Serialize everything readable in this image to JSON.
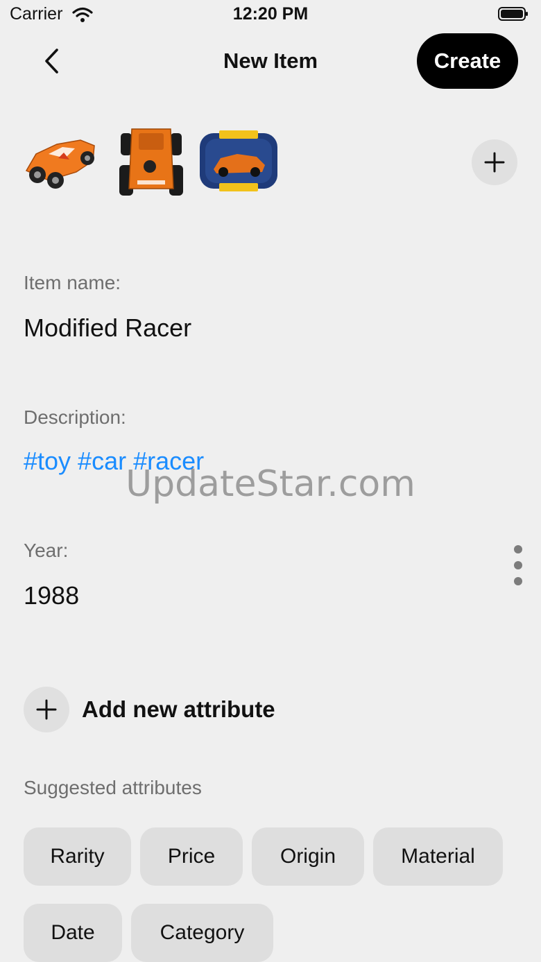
{
  "status_bar": {
    "carrier": "Carrier",
    "time": "12:20 PM"
  },
  "nav": {
    "title": "New Item",
    "create_label": "Create"
  },
  "form": {
    "name_label": "Item name:",
    "name_value": "Modified Racer",
    "description_label": "Description:",
    "description_value": "#toy #car #racer",
    "year_label": "Year:",
    "year_value": "1988"
  },
  "add_attribute_label": "Add new attribute",
  "suggested": {
    "label": "Suggested attributes",
    "chips": [
      "Rarity",
      "Price",
      "Origin",
      "Material",
      "Date",
      "Category"
    ]
  },
  "watermark": "UpdateStar.com",
  "colors": {
    "accent": "#1a8cff",
    "background": "#efefef",
    "chip": "#dedede",
    "primary_button": "#000000"
  }
}
